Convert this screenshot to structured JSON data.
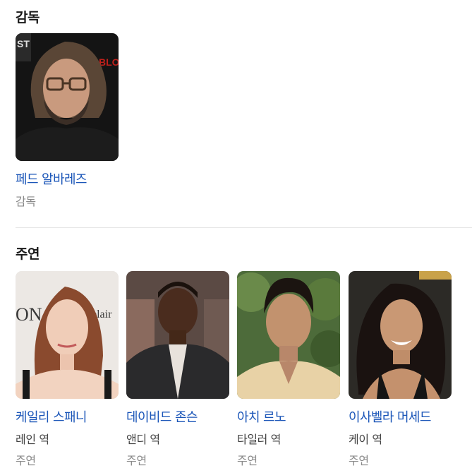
{
  "director": {
    "section_title": "감독",
    "people": [
      {
        "name": "페드 알바레즈",
        "category": "감독"
      }
    ]
  },
  "cast": {
    "section_title": "주연",
    "people": [
      {
        "name": "케일리 스패니",
        "role": "레인 역",
        "category": "주연"
      },
      {
        "name": "데이비드 존슨",
        "role": "앤디 역",
        "category": "주연"
      },
      {
        "name": "아치 르노",
        "role": "타일러 역",
        "category": "주연"
      },
      {
        "name": "이사벨라 머세드",
        "role": "케이 역",
        "category": "주연"
      }
    ]
  }
}
